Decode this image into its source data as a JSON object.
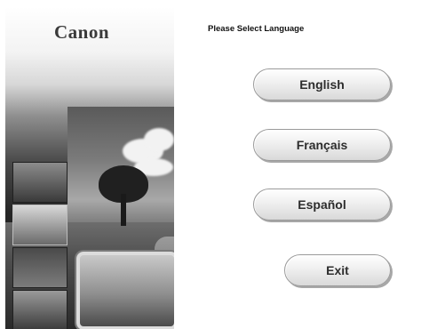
{
  "brand": {
    "logo_text": "Canon"
  },
  "prompt": {
    "text": "Please Select Language"
  },
  "buttons": {
    "english": "English",
    "francais": "Français",
    "espanol": "Español",
    "exit": "Exit"
  }
}
